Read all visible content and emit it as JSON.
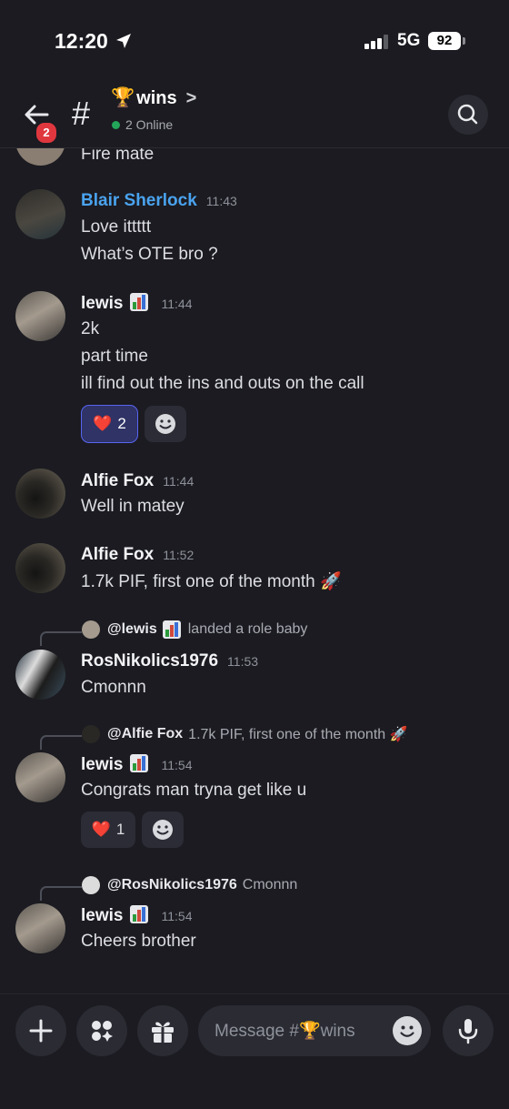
{
  "status_bar": {
    "time": "12:20",
    "network": "5G",
    "battery": "92"
  },
  "header": {
    "back_badge": "2",
    "hash": "#",
    "channel_emoji": "🏆",
    "channel_name": "wins",
    "chevron": ">",
    "online_text": "2 Online"
  },
  "messages": [
    {
      "partial_text": "Fire mate"
    },
    {
      "user": "Blair Sherlock",
      "time": "11:43",
      "lines": [
        "Love ittttt",
        "What’s OTE bro ?"
      ]
    },
    {
      "user": "lewis",
      "time": "11:44",
      "lines": [
        "2k",
        "part time",
        "ill find out the ins and outs on the call"
      ],
      "reaction": {
        "emoji": "❤️",
        "count": "2"
      }
    },
    {
      "user": "Alfie Fox",
      "time": "11:44",
      "lines": [
        "Well in matey"
      ]
    },
    {
      "user": "Alfie Fox",
      "time": "11:52",
      "lines": [
        "1.7k PIF, first one of the month 🚀"
      ]
    },
    {
      "reply_user": "@lewis",
      "reply_text": "landed a role baby",
      "user": "RosNikolics1976",
      "time": "11:53",
      "lines": [
        "Cmonnn"
      ]
    },
    {
      "reply_user": "@Alfie Fox",
      "reply_text": "1.7k PIF, first one of the month 🚀",
      "user": "lewis",
      "time": "11:54",
      "lines": [
        "Congrats man tryna get like u"
      ],
      "reaction": {
        "emoji": "❤️",
        "count": "1"
      }
    },
    {
      "reply_user": "@RosNikolics1976",
      "reply_text": "Cmonnn",
      "user": "lewis",
      "time": "11:54",
      "lines": [
        "Cheers brother"
      ]
    }
  ],
  "composer": {
    "placeholder": "Message #🏆wins"
  },
  "icons": {
    "back": "arrow-left-icon",
    "search": "search-icon",
    "plus": "plus-icon",
    "apps": "apps-icon",
    "gift": "gift-icon",
    "emoji": "smiley-icon",
    "mic": "microphone-icon"
  },
  "colors": {
    "background": "#1b1b21",
    "online": "#23a55a",
    "accent": "#5865f2",
    "badge": "#e0373f",
    "mention_user": "#4aa3ef"
  }
}
